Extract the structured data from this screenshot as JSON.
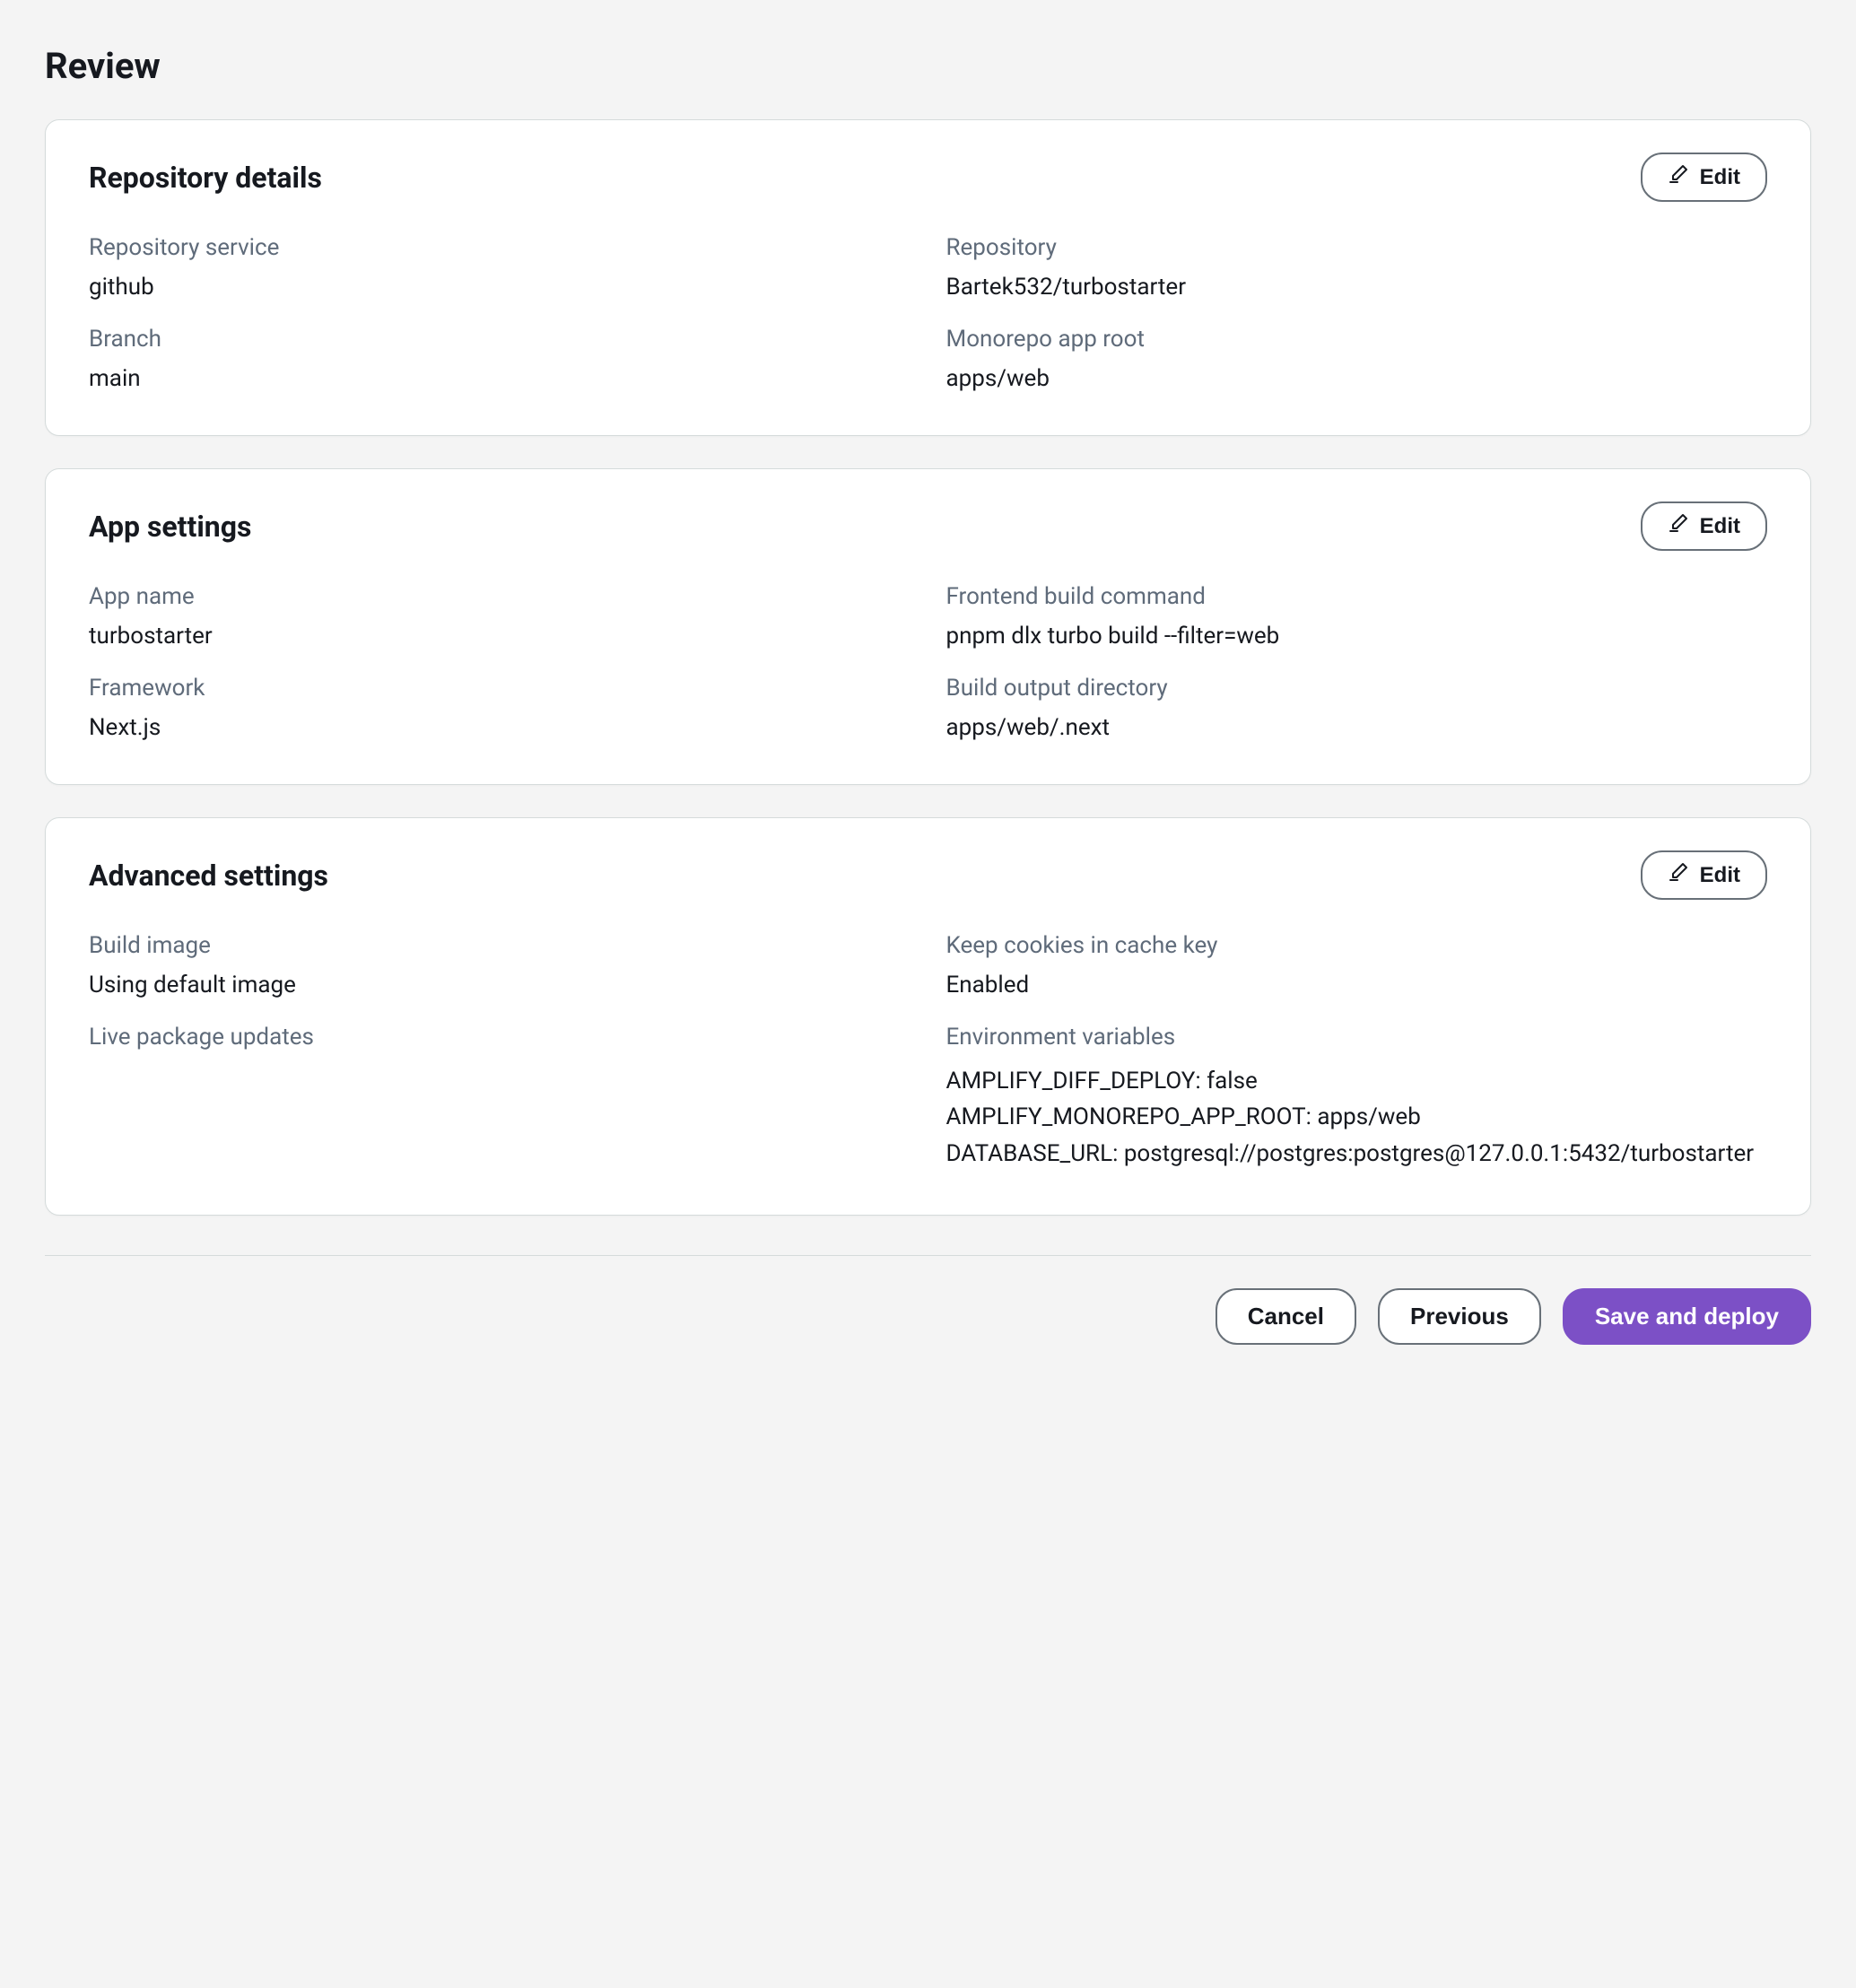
{
  "page": {
    "title": "Review"
  },
  "buttons": {
    "edit": "Edit",
    "cancel": "Cancel",
    "previous": "Previous",
    "save_deploy": "Save and deploy"
  },
  "repo": {
    "title": "Repository details",
    "service_label": "Repository service",
    "service_value": "github",
    "repo_label": "Repository",
    "repo_value": "Bartek532/turbostarter",
    "branch_label": "Branch",
    "branch_value": "main",
    "monorepo_label": "Monorepo app root",
    "monorepo_value": "apps/web"
  },
  "app": {
    "title": "App settings",
    "name_label": "App name",
    "name_value": "turbostarter",
    "build_cmd_label": "Frontend build command",
    "build_cmd_value": "pnpm dlx turbo build --filter=web",
    "framework_label": "Framework",
    "framework_value": "Next.js",
    "output_label": "Build output directory",
    "output_value": "apps/web/.next"
  },
  "advanced": {
    "title": "Advanced settings",
    "build_image_label": "Build image",
    "build_image_value": "Using default image",
    "cookies_label": "Keep cookies in cache key",
    "cookies_value": "Enabled",
    "live_pkg_label": "Live package updates",
    "env_label": "Environment variables",
    "env_vars": [
      {
        "key": "AMPLIFY_DIFF_DEPLOY",
        "value": "false"
      },
      {
        "key": "AMPLIFY_MONOREPO_APP_ROOT",
        "value": "apps/web"
      },
      {
        "key": "DATABASE_URL",
        "value": "postgresql://postgres:postgres@127.0.0.1:5432/turbostarter"
      }
    ]
  }
}
